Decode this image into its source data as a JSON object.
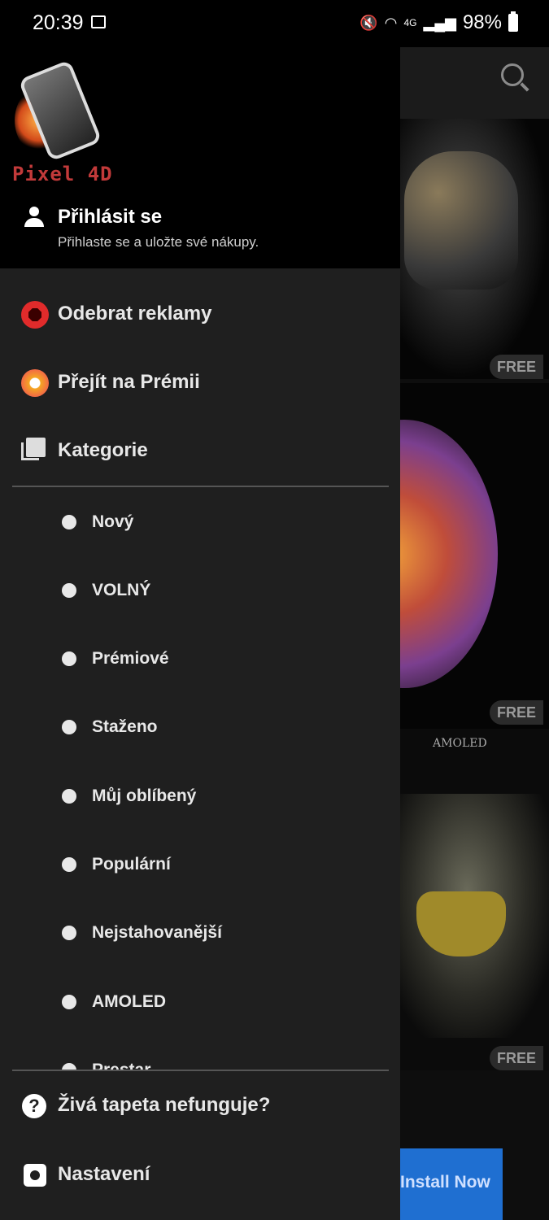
{
  "status_bar": {
    "time": "20:39",
    "network": "4G",
    "battery": "98%"
  },
  "drawer": {
    "logo_text": "Pixel 4D",
    "signin": {
      "title": "Přihlásit se",
      "subtitle": "Přihlaste se a uložte své nákupy."
    },
    "menu": [
      {
        "label": "Odebrat reklamy",
        "icon": "stop-hand-icon"
      },
      {
        "label": "Přejít na Prémii",
        "icon": "premium-crown-icon"
      },
      {
        "label": "Kategorie",
        "icon": "gallery-icon"
      }
    ],
    "categories": [
      "Nový",
      "VOLNÝ",
      "Prémiové",
      "Staženo",
      "Můj oblíbený",
      "Populární",
      "Nejstahovanější",
      "AMOLED",
      "Prestar"
    ],
    "bottom": [
      {
        "label": "Živá tapeta nefunguje?",
        "icon": "help-icon"
      },
      {
        "label": "Nastavení",
        "icon": "settings-icon"
      }
    ]
  },
  "background": {
    "badge1": "FREE",
    "badge2": "FREE",
    "badge3": "FREE",
    "card3_label": "AMOLED",
    "install_label": "Install Now"
  },
  "colors": {
    "drawer_bg": "#1f1f1f",
    "header_bg": "#000000",
    "accent_red": "#e12b2b",
    "install_blue": "#1f6fd1"
  }
}
